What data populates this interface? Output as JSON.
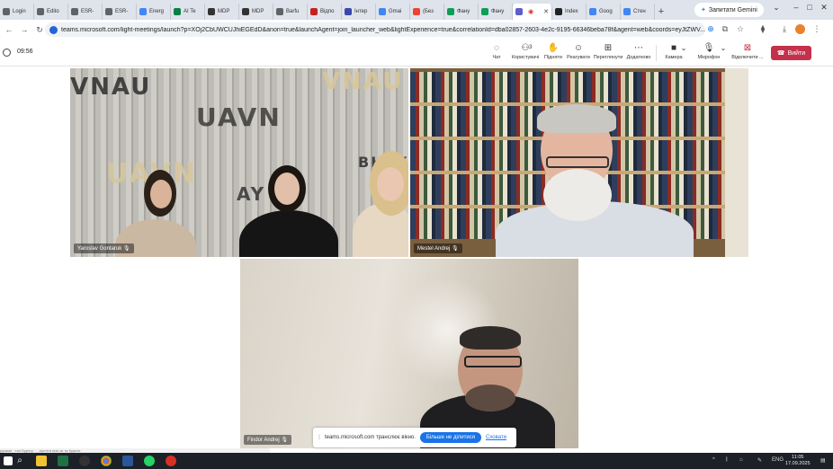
{
  "browser": {
    "tabs": [
      {
        "label": "Login",
        "icon": "page-icon",
        "color": "#5f6368"
      },
      {
        "label": "Edito",
        "icon": "globe-icon",
        "color": "#5f6368"
      },
      {
        "label": "ESR-",
        "icon": "globe-icon",
        "color": "#5f6368"
      },
      {
        "label": "ESR-",
        "icon": "globe-icon",
        "color": "#5f6368"
      },
      {
        "label": "Energ",
        "icon": "google-icon",
        "color": "#4285f4"
      },
      {
        "label": "AI Te",
        "icon": "ai-icon",
        "color": "#0b8043"
      },
      {
        "label": "MDP",
        "icon": "mdpi-icon",
        "color": "#333333"
      },
      {
        "label": "MDP",
        "icon": "mdpi-icon",
        "color": "#333333"
      },
      {
        "label": "Barfu",
        "icon": "page-icon",
        "color": "#5f6368"
      },
      {
        "label": "Відпо",
        "icon": "mail-icon",
        "color": "#c5221f"
      },
      {
        "label": "Інтер",
        "icon": "site-icon",
        "color": "#3949ab"
      },
      {
        "label": "Gmai",
        "icon": "google-icon",
        "color": "#4285f4"
      },
      {
        "label": "(Без",
        "icon": "gmail-icon",
        "color": "#ea4335"
      },
      {
        "label": "Фану",
        "icon": "drive-icon",
        "color": "#0f9d58"
      },
      {
        "label": "Фану",
        "icon": "drive-icon",
        "color": "#0f9d58"
      },
      {
        "label": "",
        "icon": "teams-icon",
        "color": "#5b5fc7",
        "active": true
      },
      {
        "label": "Index",
        "icon": "a-icon",
        "color": "#222222"
      },
      {
        "label": "Goog",
        "icon": "google-icon",
        "color": "#4285f4"
      },
      {
        "label": "Стен",
        "icon": "gemini-icon",
        "color": "#4285f4"
      }
    ],
    "gemini_label": "Запитати Gemini",
    "url": "teams.microsoft.com/light-meetings/launch?p=XOj2CbUWCUJhiEGEdD&anon=true&launchAgent=join_launcher_web&lightExperience=true&correlationId=dba02857-2603-4e2c-9195-66346beba78f&agent=web&coords=eyJtZWV..."
  },
  "meeting": {
    "timer": "09:56",
    "toolbar": {
      "chat": "Чат",
      "people": "Користувачі",
      "people_count": "3",
      "raise": "Підняти",
      "react": "Реагувати",
      "view": "Переглянути",
      "more": "Додатково",
      "camera": "Камера",
      "mic": "Мікрофон",
      "share": "Відключити ...",
      "leave": "Вийти"
    },
    "participants": [
      {
        "name": "Yaroslav Gontaruk"
      },
      {
        "name": "Mestel Andrej"
      },
      {
        "name": "Findor Andrej"
      }
    ],
    "wall_text": [
      "VNAU",
      "UAVN",
      "VNAU",
      "BHAY",
      "UAVN",
      "AY"
    ],
    "share_bar": {
      "text": "teams.microsoft.com транслює вікно.",
      "stop": "Більше не ділитися",
      "hide": "Сховати"
    }
  },
  "taskbar": {
    "snippet": "руками · тил Бургер · ...ерстіти пізн зи та Курити",
    "lang": "ENG",
    "time": "11:05",
    "date": "17.09.2025"
  }
}
